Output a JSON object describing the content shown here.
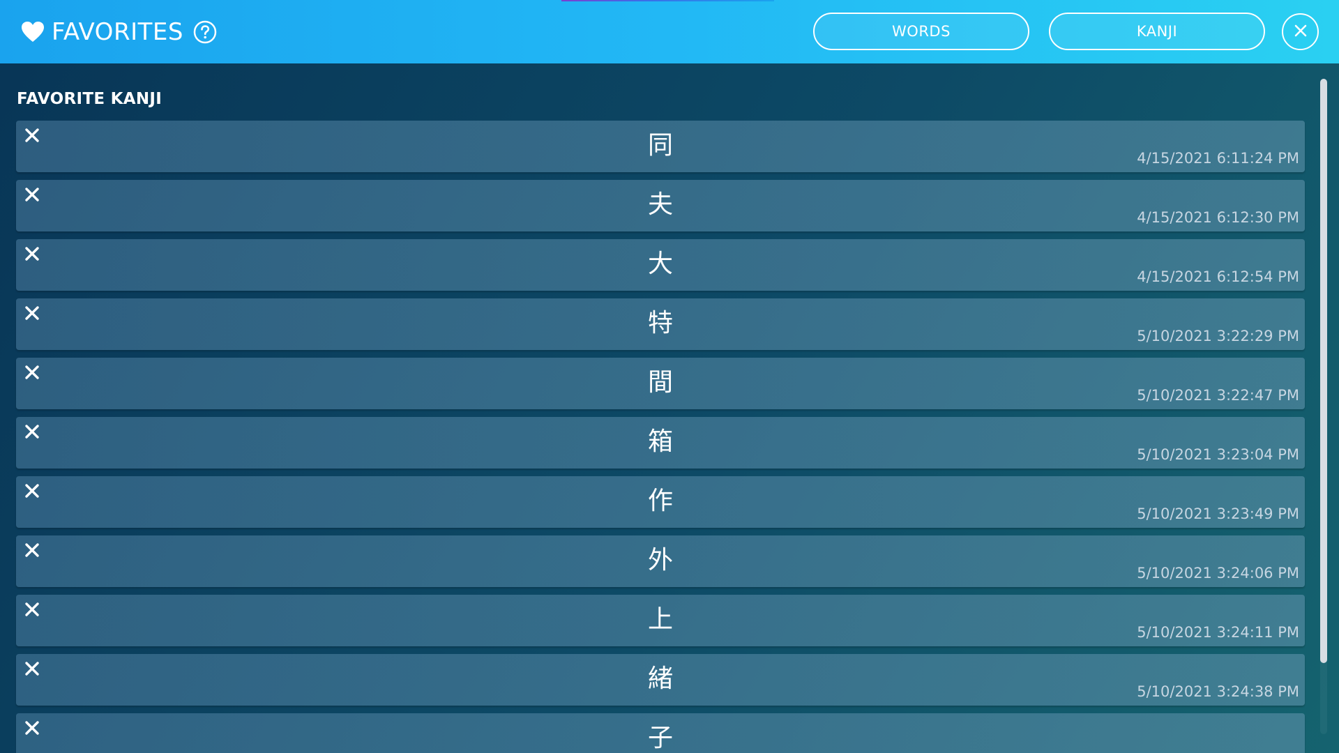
{
  "header": {
    "title": "FAVORITES",
    "icons": {
      "favorites": "heart-icon",
      "help": "help-icon",
      "close": "close-icon"
    },
    "buttons": {
      "words": "WORDS",
      "kanji": "KANJI"
    },
    "colors": {
      "header_start": "#1aa3ee",
      "header_end": "#2ad0f2"
    }
  },
  "main": {
    "section_title": "FAVORITE KANJI",
    "items": [
      {
        "kanji": "同",
        "date": "4/15/2021 6:11:24 PM"
      },
      {
        "kanji": "夫",
        "date": "4/15/2021 6:12:30 PM"
      },
      {
        "kanji": "大",
        "date": "4/15/2021 6:12:54 PM"
      },
      {
        "kanji": "特",
        "date": "5/10/2021 3:22:29 PM"
      },
      {
        "kanji": "間",
        "date": "5/10/2021 3:22:47 PM"
      },
      {
        "kanji": "箱",
        "date": "5/10/2021 3:23:04 PM"
      },
      {
        "kanji": "作",
        "date": "5/10/2021 3:23:49 PM"
      },
      {
        "kanji": "外",
        "date": "5/10/2021 3:24:06 PM"
      },
      {
        "kanji": "上",
        "date": "5/10/2021 3:24:11 PM"
      },
      {
        "kanji": "緒",
        "date": "5/10/2021 3:24:38 PM"
      },
      {
        "kanji": "子",
        "date": ""
      }
    ]
  }
}
